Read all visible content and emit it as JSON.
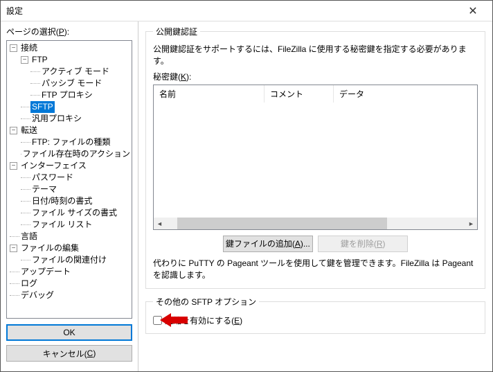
{
  "window": {
    "title": "設定"
  },
  "left": {
    "label": "ページの選択(P):",
    "tree": {
      "connection": {
        "label": "接続"
      },
      "ftp": {
        "label": "FTP"
      },
      "active": {
        "label": "アクティブ モード"
      },
      "passive": {
        "label": "パッシブ モード"
      },
      "ftpproxy": {
        "label": "FTP プロキシ"
      },
      "sftp": {
        "label": "SFTP"
      },
      "genproxy": {
        "label": "汎用プロキシ"
      },
      "transfer": {
        "label": "転送"
      },
      "ftptype": {
        "label": "FTP: ファイルの種類"
      },
      "fileexists": {
        "label": "ファイル存在時のアクション"
      },
      "interface": {
        "label": "インターフェイス"
      },
      "password": {
        "label": "パスワード"
      },
      "theme": {
        "label": "テーマ"
      },
      "datetime": {
        "label": "日付/時刻の書式"
      },
      "filesize": {
        "label": "ファイル サイズの書式"
      },
      "filelist": {
        "label": "ファイル リスト"
      },
      "language": {
        "label": "言語"
      },
      "fileedit": {
        "label": "ファイルの編集"
      },
      "assoc": {
        "label": "ファイルの関連付け"
      },
      "update": {
        "label": "アップデート"
      },
      "log": {
        "label": "ログ"
      },
      "debug": {
        "label": "デバッグ"
      }
    },
    "ok": "OK",
    "cancel": "キャンセル(C)"
  },
  "right": {
    "group1": {
      "legend": "公開鍵認証",
      "desc": "公開鍵認証をサポートするには、FileZilla に使用する秘密鍵を指定する必要があります。",
      "keylabel": "秘密鍵(K):",
      "col1": "名前",
      "col2": "コメント",
      "col3": "データ",
      "add": "鍵ファイルの追加(A)...",
      "remove": "鍵を削除(R)",
      "note": "代わりに PuTTY の Pageant ツールを使用して鍵を管理できます。FileZilla は Pageant を認識します。"
    },
    "group2": {
      "legend": "その他の SFTP オプション",
      "compress": "圧縮を有効にする(E)"
    }
  }
}
